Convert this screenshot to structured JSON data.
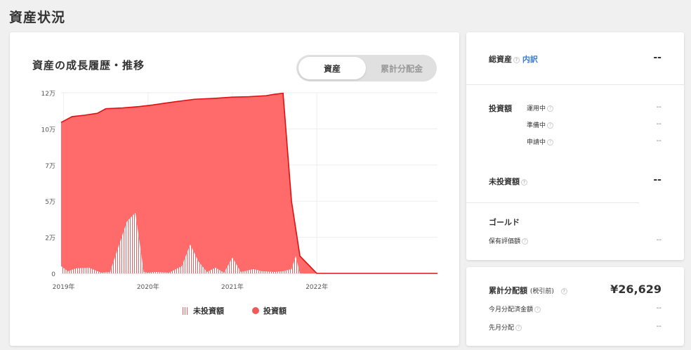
{
  "page": {
    "title": "資産状況"
  },
  "chart_card": {
    "title": "資産の成長履歴・推移",
    "toggle": {
      "active": "資産",
      "inactive": "累計分配金"
    },
    "legend": {
      "uninvested": "未投資額",
      "invested": "投資額"
    }
  },
  "chart_data": {
    "type": "area",
    "y_tick_labels": [
      "0",
      "2万",
      "5万",
      "7万",
      "10万",
      "12万"
    ],
    "y_ticks": [
      0,
      25000,
      50000,
      75000,
      100000,
      125000
    ],
    "ylim": [
      0,
      125000
    ],
    "x_tick_labels": [
      "2019年",
      "2020年",
      "2021年",
      "2022年"
    ],
    "x_ticks": [
      2019,
      2020,
      2021,
      2022
    ],
    "xlim": [
      2018.97,
      2023.43
    ],
    "grid": true,
    "series": [
      {
        "name": "投資額",
        "color": "#f05a5a",
        "x": [
          2018.97,
          2019.1,
          2019.25,
          2019.4,
          2019.5,
          2019.7,
          2019.9,
          2020.05,
          2020.2,
          2020.35,
          2020.55,
          2020.8,
          2021.0,
          2021.2,
          2021.4,
          2021.5,
          2021.55,
          2021.6,
          2021.7,
          2021.8,
          2022.0,
          2022.2,
          2023.43
        ],
        "values": [
          104500,
          108500,
          109500,
          110800,
          114000,
          114500,
          115500,
          116500,
          117800,
          119000,
          120500,
          121200,
          122000,
          122300,
          123000,
          124000,
          124300,
          124700,
          50000,
          12000,
          0,
          0,
          0
        ]
      },
      {
        "name": "未投資額",
        "color": "#e86060",
        "x": [
          2018.97,
          2019.05,
          2019.15,
          2019.3,
          2019.4,
          2019.45,
          2019.55,
          2019.75,
          2019.85,
          2019.95,
          2020.0,
          2020.1,
          2020.25,
          2020.4,
          2020.5,
          2020.6,
          2020.7,
          2020.8,
          2020.9,
          2021.0,
          2021.1,
          2021.25,
          2021.35,
          2021.5,
          2021.6,
          2021.7,
          2021.75,
          2021.8
        ],
        "values": [
          5000,
          1500,
          3500,
          4000,
          1500,
          500,
          1000,
          36000,
          42000,
          1000,
          500,
          1000,
          500,
          5000,
          20000,
          8000,
          1000,
          4000,
          500,
          11000,
          1000,
          3000,
          1500,
          1000,
          1500,
          3000,
          12000,
          0
        ]
      }
    ]
  },
  "summary": {
    "total_assets_label": "総資産",
    "breakdown_link": "内訳",
    "total_assets_value": "--",
    "investment_label": "投資額",
    "operating_label": "運用中",
    "operating_value": "--",
    "preparing_label": "準備中",
    "preparing_value": "--",
    "applying_label": "申請中",
    "applying_value": "--",
    "uninvested_label": "未投資額",
    "uninvested_value": "--",
    "gold_label": "ゴールド",
    "gold_holding_label": "保有評価額",
    "gold_holding_value": "--"
  },
  "distribution": {
    "label": "累計分配額",
    "tax_note": "(税引前)",
    "amount": "¥26,629",
    "this_month_label": "今月分配済金額",
    "this_month_value": "--",
    "last_month_label": "先月分配",
    "last_month_value": "--"
  },
  "icons": {
    "help": "help-circle-icon"
  }
}
